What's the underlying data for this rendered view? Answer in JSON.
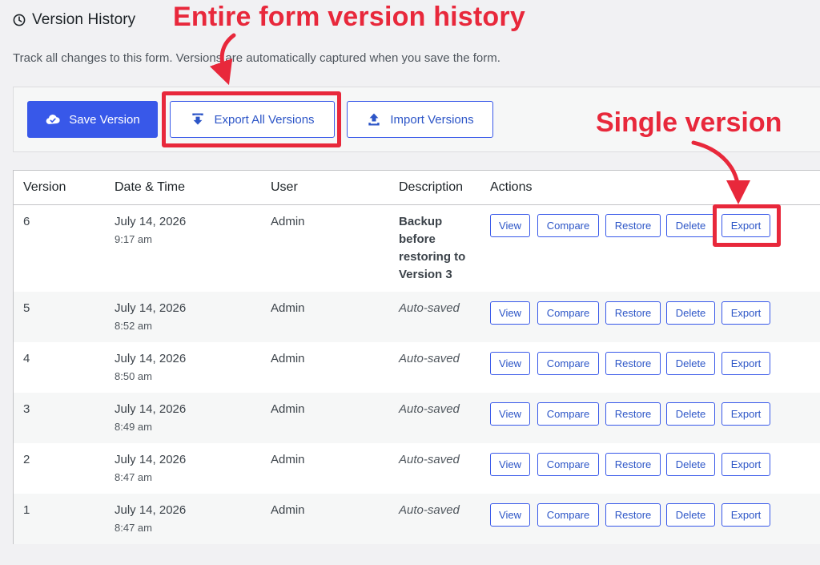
{
  "page": {
    "title": "Version History",
    "subtitle": "Track all changes to this form. Versions are automatically captured when you save the form."
  },
  "toolbar": {
    "save_label": "Save Version",
    "export_all_label": "Export All Versions",
    "import_label": "Import Versions"
  },
  "annotations": {
    "entire": "Entire form version history",
    "single": "Single version",
    "color": "#e8283b"
  },
  "table": {
    "headers": [
      "Version",
      "Date & Time",
      "User",
      "Description",
      "Actions"
    ],
    "action_labels": [
      "View",
      "Compare",
      "Restore",
      "Delete",
      "Export"
    ],
    "rows": [
      {
        "version": "6",
        "date": "July 14, 2026",
        "time": "9:17 am",
        "user": "Admin",
        "description": "Backup before restoring to Version 3"
      },
      {
        "version": "5",
        "date": "July 14, 2026",
        "time": "8:52 am",
        "user": "Admin",
        "description": "Auto-saved"
      },
      {
        "version": "4",
        "date": "July 14, 2026",
        "time": "8:50 am",
        "user": "Admin",
        "description": "Auto-saved"
      },
      {
        "version": "3",
        "date": "July 14, 2026",
        "time": "8:49 am",
        "user": "Admin",
        "description": "Auto-saved"
      },
      {
        "version": "2",
        "date": "July 14, 2026",
        "time": "8:47 am",
        "user": "Admin",
        "description": "Auto-saved"
      },
      {
        "version": "1",
        "date": "July 14, 2026",
        "time": "8:47 am",
        "user": "Admin",
        "description": "Auto-saved"
      }
    ]
  },
  "colors": {
    "primary": "#3858e9",
    "link": "#2c55c7",
    "background": "#f1f1f3"
  },
  "icons": [
    "clock-icon",
    "cloud-check-icon",
    "download-arrow-icon",
    "upload-arrow-icon"
  ]
}
